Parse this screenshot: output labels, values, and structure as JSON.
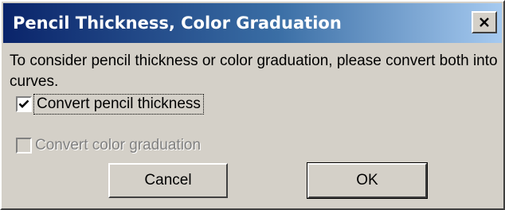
{
  "window": {
    "title": "Pencil Thickness, Color Graduation"
  },
  "message": "To consider pencil thickness or color graduation, please convert both into curves.",
  "options": [
    {
      "label": "Convert pencil thickness",
      "checked": true,
      "enabled": true
    },
    {
      "label": "Convert color graduation",
      "checked": false,
      "enabled": false
    }
  ],
  "buttons": {
    "cancel_label": "Cancel",
    "ok_label": "OK"
  },
  "icons": {
    "close": "close-icon",
    "checkmark": "checkmark-icon"
  },
  "colors": {
    "titlebar_start": "#0a246a",
    "titlebar_end": "#a6caf0",
    "face": "#d4d0c8"
  }
}
